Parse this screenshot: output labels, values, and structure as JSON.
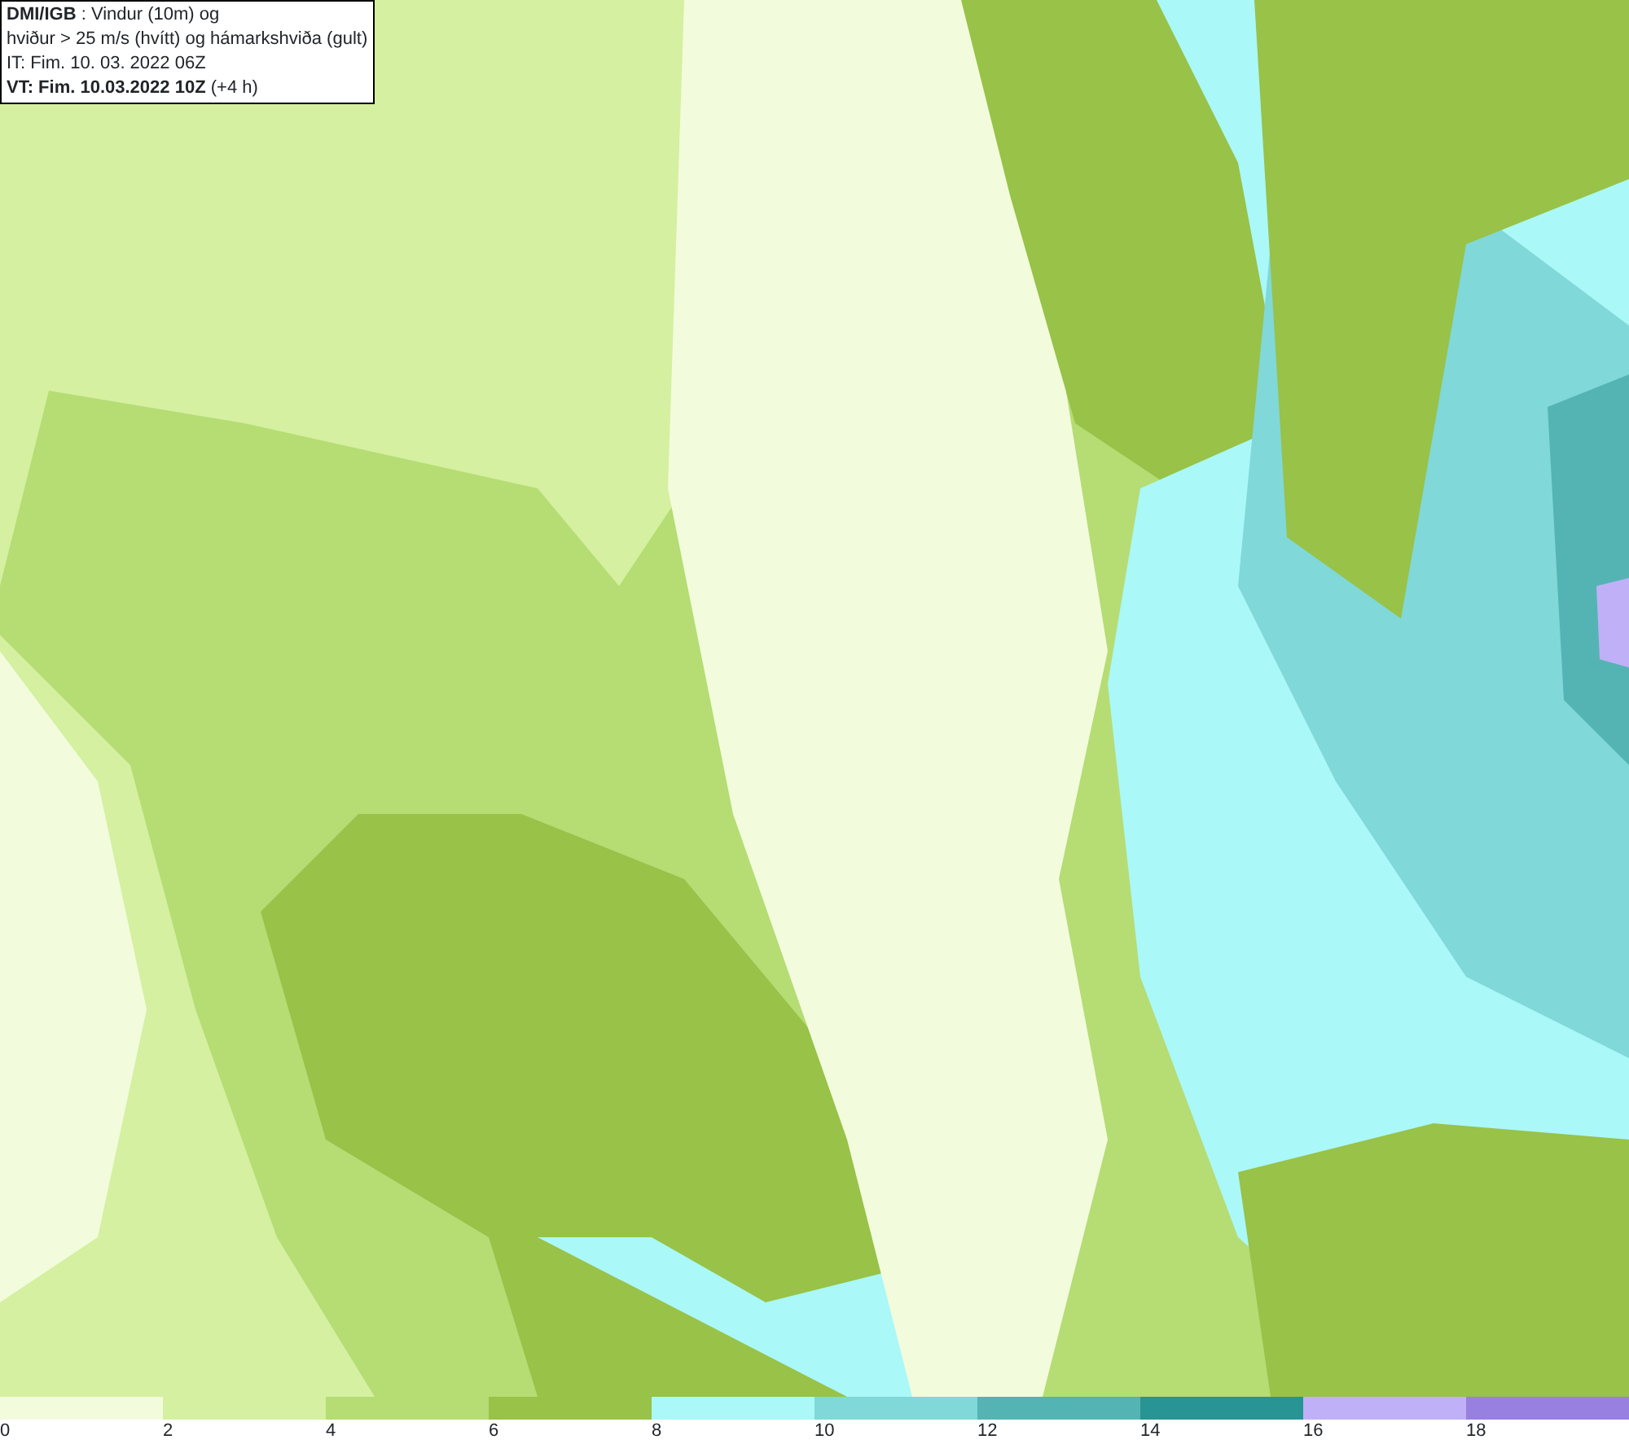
{
  "title_box": {
    "lines": [
      "**DMI/IGB** : Vindur (10m) og",
      "hviður > 25 m/s (hvítt) og hámarkshviða (gult)",
      "IT: Fim. 10. 03. 2022 06Z",
      "**VT: Fim. 10.03.2022 10Z** (+4 h)"
    ]
  },
  "legend": {
    "bins": [
      {
        "color": "#f2fcdc",
        "label": "0"
      },
      {
        "color": "#d4f0a0",
        "label": "2"
      },
      {
        "color": "#b6dc74",
        "label": "4"
      },
      {
        "color": "#98c248",
        "label": "6"
      },
      {
        "color": "#aaf8f8",
        "label": "8"
      },
      {
        "color": "#80d8d8",
        "label": "10"
      },
      {
        "color": "#54b4b4",
        "label": "12"
      },
      {
        "color": "#289494",
        "label": "14"
      },
      {
        "color": "#c0b0f8",
        "label": "16"
      },
      {
        "color": "#9880e0",
        "label": "18"
      }
    ]
  }
}
